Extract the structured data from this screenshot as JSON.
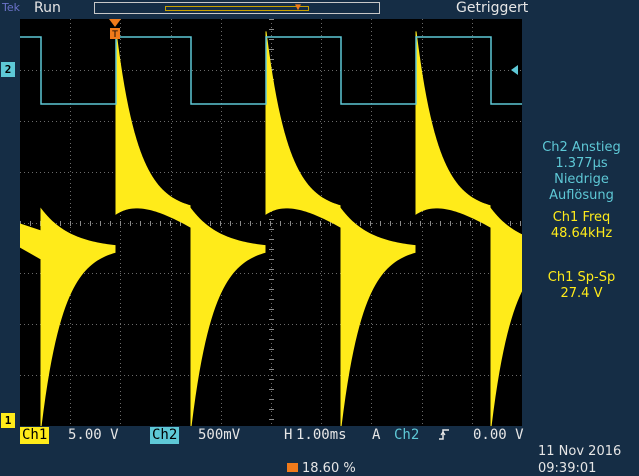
{
  "header": {
    "brand": "Tek",
    "run_state": "Run",
    "trigger_state": "Getriggert"
  },
  "channel_markers": {
    "ch2": "2",
    "ch1": "1"
  },
  "measurements": {
    "ch2_rise_label": "Ch2 Anstieg",
    "ch2_rise_value": "1.377µs",
    "ch2_rise_note1": "Niedrige",
    "ch2_rise_note2": "Auflösung",
    "ch1_freq_label": "Ch1 Freq",
    "ch1_freq_value": "48.64kHz",
    "ch1_pp_label": "Ch1 Sp-Sp",
    "ch1_pp_value": "27.4 V"
  },
  "bottom": {
    "ch1_label": "Ch1",
    "ch1_scale": "5.00 V",
    "ch2_label": "Ch2",
    "ch2_scale": "500mV",
    "timebase_label": "H",
    "timebase": "1.00ms",
    "trigger_mode": "A",
    "trigger_source": "Ch2",
    "trigger_slope_icon": "rising-edge-icon",
    "trigger_level": "0.00 V"
  },
  "footer": {
    "trigger_percent": "18.60 %",
    "date": "11 Nov 2016",
    "time": "09:39:01"
  },
  "colors": {
    "background": "#152d45",
    "ch1": "#ffeb1a",
    "ch2": "#5ec8d6",
    "trigger": "#f07a1a"
  }
}
